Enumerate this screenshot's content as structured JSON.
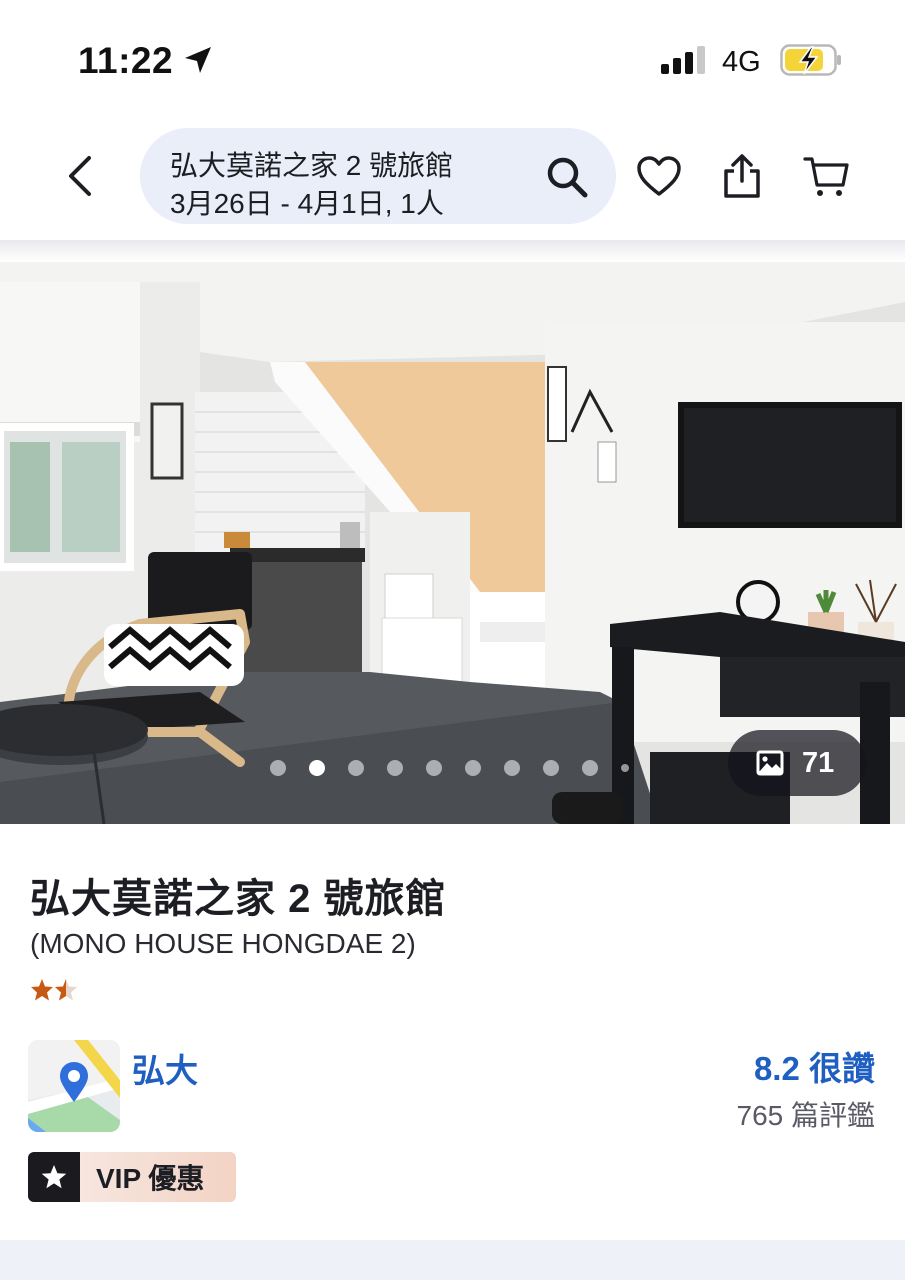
{
  "status_bar": {
    "time": "11:22",
    "network": "4G",
    "icons": [
      "location-arrow-icon",
      "signal-bars-icon",
      "battery-charging-icon"
    ]
  },
  "header": {
    "search_title": "弘大莫諾之家 2 號旅館",
    "search_dates": "3月26日 - 4月1日, 1人",
    "icons": [
      "back-arrow-icon",
      "search-icon",
      "heart-icon",
      "share-icon",
      "cart-icon"
    ]
  },
  "gallery": {
    "photo_count": "71",
    "dot_count": 10,
    "active_dot": 1,
    "icon": "image-icon"
  },
  "hotel": {
    "name": "弘大莫諾之家 2 號旅館",
    "name_en": "(MONO HOUSE HONGDAE 2)",
    "star_rating": 1.5,
    "area": "弘大",
    "score": "8.2 很讚",
    "review_count": "765 篇評鑑",
    "vip_label": "VIP 優惠"
  },
  "colors": {
    "accent_blue": "#1f5fc2",
    "search_pill_bg": "#eaeef8",
    "star_orange": "#c75a12",
    "vip_bg": "#f3d3c4",
    "bottom_band": "#eef1f8"
  }
}
